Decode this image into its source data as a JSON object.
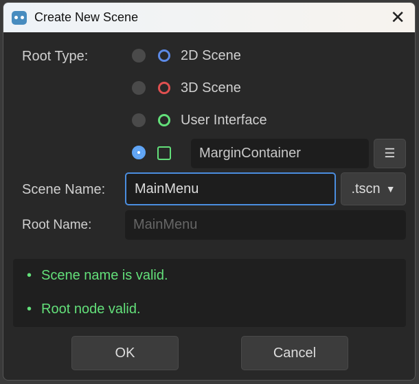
{
  "title": "Create New Scene",
  "root_type_label": "Root Type:",
  "options": [
    {
      "label": "2D Scene",
      "color": "#5c8ae6"
    },
    {
      "label": "3D Scene",
      "color": "#e05050"
    },
    {
      "label": "User Interface",
      "color": "#63e07a"
    }
  ],
  "custom_node": "MarginContainer",
  "scene_name_label": "Scene Name:",
  "scene_name_value": "MainMenu",
  "extension": ".tscn",
  "root_name_label": "Root Name:",
  "root_name_placeholder": "MainMenu",
  "status": [
    "Scene name is valid.",
    "Root node valid."
  ],
  "ok": "OK",
  "cancel": "Cancel"
}
